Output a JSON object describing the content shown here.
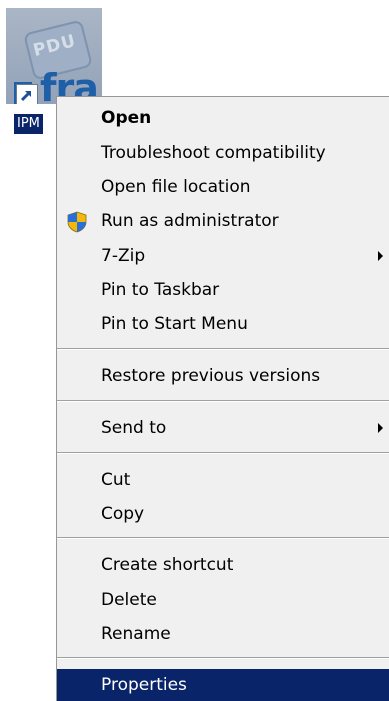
{
  "desktop_icon": {
    "image_text_top": "PDU",
    "image_text_bottom": "fra",
    "label": "IPM"
  },
  "context_menu": {
    "items": [
      {
        "label": "Open",
        "bold": true
      },
      {
        "label": "Troubleshoot compatibility"
      },
      {
        "label": "Open file location"
      },
      {
        "label": "Run as administrator",
        "icon": "uac-shield-icon"
      },
      {
        "label": "7-Zip",
        "submenu": true
      },
      {
        "label": "Pin to Taskbar"
      },
      {
        "label": "Pin to Start Menu"
      },
      {
        "label": "Restore previous versions"
      },
      {
        "label": "Send to",
        "submenu": true
      },
      {
        "label": "Cut"
      },
      {
        "label": "Copy"
      },
      {
        "label": "Create shortcut"
      },
      {
        "label": "Delete"
      },
      {
        "label": "Rename"
      },
      {
        "label": "Properties",
        "selected": true
      }
    ]
  },
  "colors": {
    "menu_background": "#f0f0f0",
    "selection": "#0a246a",
    "selection_text": "#ffffff",
    "separator": "#a0a0a0"
  }
}
